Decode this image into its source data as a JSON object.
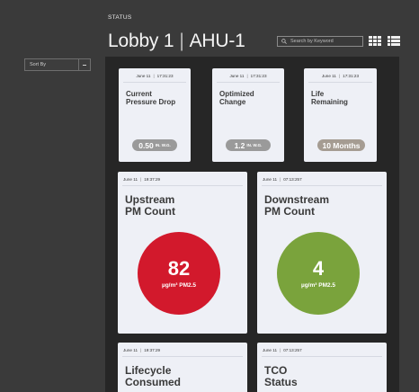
{
  "sidebar": {
    "sort_label": "Sort By"
  },
  "header": {
    "label": "STATUS",
    "location": "Lobby 1",
    "unit": "AHU-1",
    "search_placeholder": "Search by Keyword"
  },
  "colors": {
    "red": "#d2192c",
    "green": "#7aa33c",
    "pill_gray": "#9a9a9a",
    "pill_taupe": "#a59c92"
  },
  "cards": [
    {
      "date": "June 11",
      "time": "17:31:23",
      "title1": "Current",
      "title2": "Pressure Drop",
      "value": "0.50",
      "unit": "IN. W.G."
    },
    {
      "date": "June 11",
      "time": "17:31:23",
      "title1": "Optimized",
      "title2": "Change",
      "value": "1.2",
      "unit": "IN. W.G."
    },
    {
      "date": "June 11",
      "time": "17:31:23",
      "title1": "Life",
      "title2": "Remaining",
      "value": "10 Months",
      "unit": ""
    },
    {
      "date": "June 11",
      "time": "19:37:29",
      "title1": "Upstream",
      "title2": "PM Count",
      "value": "82",
      "unit": "µg/m³ PM2.5"
    },
    {
      "date": "June 11",
      "time": "07:13:257",
      "title1": "Downstream",
      "title2": "PM Count",
      "value": "4",
      "unit": "µg/m³ PM2.5"
    },
    {
      "date": "June 11",
      "time": "19:37:29",
      "title1": "Lifecycle",
      "title2": "Consumed"
    },
    {
      "date": "June 11",
      "time": "07:13:257",
      "title1": "TCO",
      "title2": "Status"
    }
  ]
}
